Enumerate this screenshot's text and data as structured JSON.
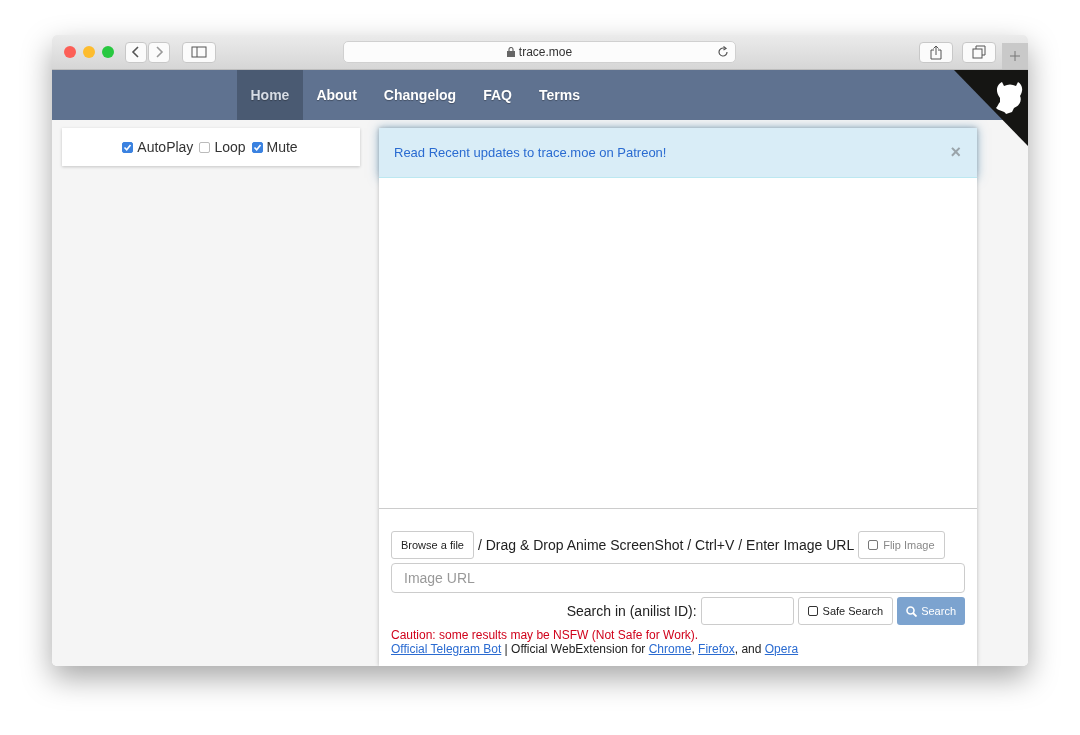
{
  "window": {
    "address": "trace.moe"
  },
  "navbar": {
    "items": [
      {
        "label": "Home",
        "selected": true
      },
      {
        "label": "About",
        "selected": false
      },
      {
        "label": "Changelog",
        "selected": false
      },
      {
        "label": "FAQ",
        "selected": false
      },
      {
        "label": "Terms",
        "selected": false
      }
    ]
  },
  "player_options": [
    {
      "label": "AutoPlay",
      "checked": true
    },
    {
      "label": "Loop",
      "checked": false
    },
    {
      "label": "Mute",
      "checked": true
    }
  ],
  "alert": {
    "text": "Read Recent updates to trace.moe on Patreon!",
    "close": "×"
  },
  "search_form": {
    "browse_button": "Browse a file",
    "instructions": "/ Drag & Drop Anime ScreenShot / Ctrl+V / Enter Image URL",
    "flip_image": {
      "label": "Flip Image",
      "checked": false
    },
    "url_field": {
      "placeholder": "Image URL"
    },
    "anilist_label": "Search in (anilist ID):",
    "safe_search": {
      "label": "Safe Search",
      "checked": false
    },
    "search_button": "Search",
    "caution": "Caution: some results may be NSFW (Not Safe for Work).",
    "footer_line": [
      {
        "kind": "link",
        "text": "Official Telegram Bot"
      },
      {
        "kind": "text",
        "text": " | Official WebExtension for "
      },
      {
        "kind": "link",
        "text": "Chrome"
      },
      {
        "kind": "text",
        "text": ", "
      },
      {
        "kind": "link",
        "text": "Firefox"
      },
      {
        "kind": "text",
        "text": ", and "
      },
      {
        "kind": "link",
        "text": "Opera"
      }
    ]
  }
}
